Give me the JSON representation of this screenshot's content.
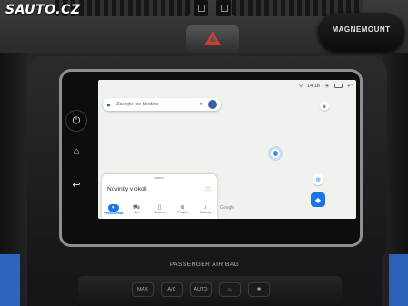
{
  "photo": {
    "watermark": "SAUTO.CZ",
    "phone_mount_brand": "MAGNEMOUNT",
    "airbag_label": "PASSENGER AIR BAG",
    "hazard_color": "#d23a2e"
  },
  "screen": {
    "status": {
      "time": "14:18",
      "icons": [
        "location-icon",
        "brightness-icon",
        "window-icon",
        "back-icon"
      ]
    },
    "search": {
      "placeholder": "Zadejte, co hledáte",
      "icon": "map-pin-icon",
      "voice_icon": "mic-icon"
    },
    "map": {
      "attribution": "Google",
      "accent_color": "#1a73e8",
      "background_color": "#f0f2ee"
    },
    "sheet": {
      "title": "Novinky v okolí",
      "info_glyph": "ⓘ"
    },
    "tabs": [
      {
        "label": "Prozkoumat",
        "icon": "pin-icon",
        "glyph": "●",
        "active": true
      },
      {
        "label": "Jet",
        "icon": "car-icon",
        "glyph": "⛟",
        "active": false
      },
      {
        "label": "Uloženo",
        "icon": "bookmark-icon",
        "glyph": "▯",
        "active": false
      },
      {
        "label": "Přispět",
        "icon": "plus-icon",
        "glyph": "⊕",
        "active": false
      },
      {
        "label": "Novinky",
        "icon": "bell-icon",
        "glyph": "♪",
        "active": false
      }
    ]
  },
  "controls": [
    "MAX",
    "A/C",
    "AUTO",
    "♨",
    "✱"
  ]
}
